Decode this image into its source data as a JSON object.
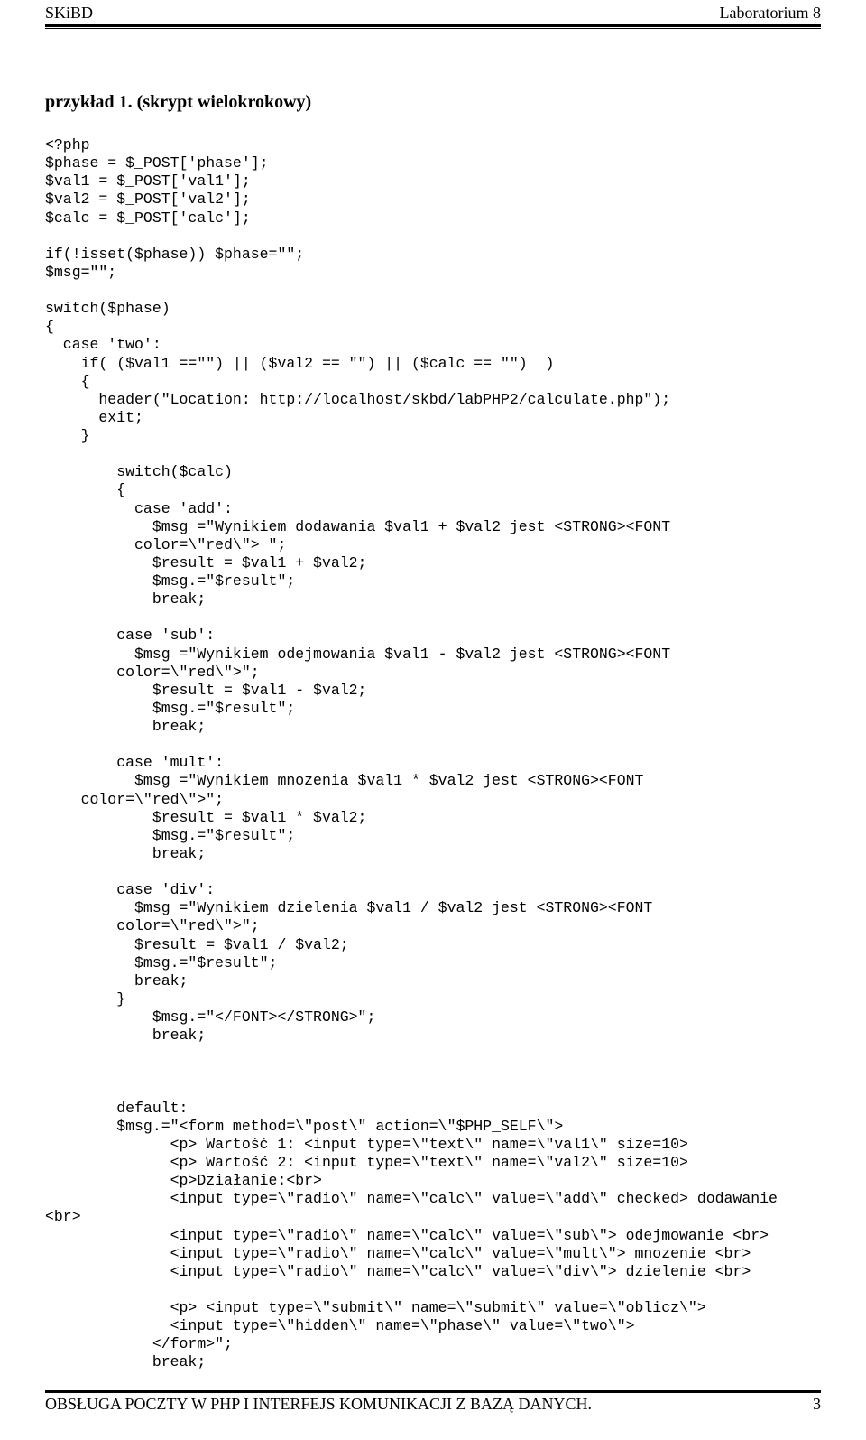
{
  "header": {
    "left": "SKiBD",
    "right": "Laboratorium 8"
  },
  "section_title": "przykład 1. (skrypt wielokrokowy)",
  "code": "<?php\n$phase = $_POST['phase'];\n$val1 = $_POST['val1'];\n$val2 = $_POST['val2'];\n$calc = $_POST['calc'];\n\nif(!isset($phase)) $phase=\"\";\n$msg=\"\";\n\nswitch($phase)\n{\n  case 'two':\n    if( ($val1 ==\"\") || ($val2 == \"\") || ($calc == \"\")  )\n    {\n      header(\"Location: http://localhost/skbd/labPHP2/calculate.php\");\n      exit;\n    }\n\n        switch($calc)\n        {\n          case 'add':\n            $msg =\"Wynikiem dodawania $val1 + $val2 jest <STRONG><FONT\n          color=\\\"red\\\"> \";\n            $result = $val1 + $val2;\n            $msg.=\"$result\";\n            break;\n\n        case 'sub':\n          $msg =\"Wynikiem odejmowania $val1 - $val2 jest <STRONG><FONT\n        color=\\\"red\\\">\";\n            $result = $val1 - $val2;\n            $msg.=\"$result\";\n            break;\n\n        case 'mult':\n          $msg =\"Wynikiem mnozenia $val1 * $val2 jest <STRONG><FONT\n    color=\\\"red\\\">\";\n            $result = $val1 * $val2;\n            $msg.=\"$result\";\n            break;\n\n        case 'div':\n          $msg =\"Wynikiem dzielenia $val1 / $val2 jest <STRONG><FONT\n        color=\\\"red\\\">\";\n          $result = $val1 / $val2;\n          $msg.=\"$result\";\n          break;\n        }\n            $msg.=\"</FONT></STRONG>\";\n            break;\n\n\n\n        default:\n        $msg.=\"<form method=\\\"post\\\" action=\\\"$PHP_SELF\\\">\n              <p> Wartość 1: <input type=\\\"text\\\" name=\\\"val1\\\" size=10>\n              <p> Wartość 2: <input type=\\\"text\\\" name=\\\"val2\\\" size=10>\n              <p>Działanie:<br>\n              <input type=\\\"radio\\\" name=\\\"calc\\\" value=\\\"add\\\" checked> dodawanie\n<br>\n              <input type=\\\"radio\\\" name=\\\"calc\\\" value=\\\"sub\\\"> odejmowanie <br>\n              <input type=\\\"radio\\\" name=\\\"calc\\\" value=\\\"mult\\\"> mnozenie <br>\n              <input type=\\\"radio\\\" name=\\\"calc\\\" value=\\\"div\\\"> dzielenie <br>\n\n              <p> <input type=\\\"submit\\\" name=\\\"submit\\\" value=\\\"oblicz\\\">\n              <input type=\\\"hidden\\\" name=\\\"phase\\\" value=\\\"two\\\">\n            </form>\";\n            break;",
  "footer": {
    "text": "OBSŁUGA POCZTY W PHP I INTERFEJS KOMUNIKACJI Z BAZĄ DANYCH.",
    "page_number": "3"
  }
}
